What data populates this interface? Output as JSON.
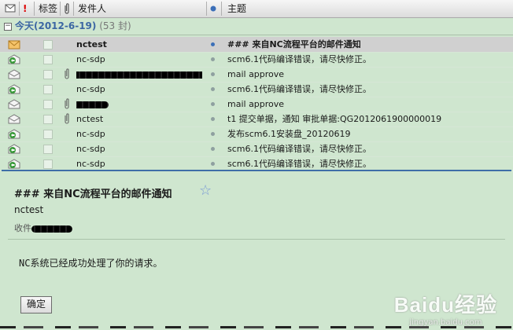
{
  "header": {
    "label_col": "标签",
    "sender_col": "发件人",
    "subject_col": "主题"
  },
  "group": {
    "title": "今天(2012-6-19)",
    "count": "(53 封)"
  },
  "rows": [
    {
      "sender": "nctest",
      "subject": "### 来自NC流程平台的邮件通知",
      "icon": "envelope-open-icon",
      "attach": false,
      "redacted": false,
      "dot_color": "#3b6fb8"
    },
    {
      "sender": "nc-sdp",
      "subject": "scm6.1代码编译错误，请尽快修正。",
      "icon": "reply-icon",
      "attach": false,
      "redacted": false,
      "dot_color": "#8fa0a0"
    },
    {
      "sender": "",
      "subject": "mail approve",
      "icon": "envelope-open-icon",
      "attach": true,
      "redacted": true,
      "dot_color": "#8fa0a0"
    },
    {
      "sender": "nc-sdp",
      "subject": "scm6.1代码编译错误，请尽快修正。",
      "icon": "reply-icon",
      "attach": false,
      "redacted": false,
      "dot_color": "#8fa0a0"
    },
    {
      "sender": "",
      "subject": "mail approve",
      "icon": "envelope-open-icon",
      "attach": true,
      "redacted": true,
      "dot_color": "#8fa0a0"
    },
    {
      "sender": "nctest",
      "subject": "t1 提交单据，通知 审批单据:QG2012061900000019",
      "icon": "envelope-open-icon",
      "attach": true,
      "redacted": false,
      "dot_color": "#8fa0a0"
    },
    {
      "sender": "nc-sdp",
      "subject": "发布scm6.1安装盘_20120619",
      "icon": "reply-icon",
      "attach": false,
      "redacted": false,
      "dot_color": "#8fa0a0"
    },
    {
      "sender": "nc-sdp",
      "subject": "scm6.1代码编译错误，请尽快修正。",
      "icon": "reply-icon",
      "attach": false,
      "redacted": false,
      "dot_color": "#8fa0a0"
    },
    {
      "sender": "nc-sdp",
      "subject": "scm6.1代码编译错误，请尽快修正。",
      "icon": "reply-icon",
      "attach": false,
      "redacted": false,
      "dot_color": "#8fa0a0"
    }
  ],
  "detail": {
    "subject": "### 来自NC流程平台的邮件通知",
    "from": "nctest",
    "to_label": "收件",
    "body": "NC系统已经成功处理了你的请求。",
    "ok_button": "确定"
  },
  "watermark": {
    "brand": "Baidu经验",
    "url": "jingyan.baidu.com"
  }
}
